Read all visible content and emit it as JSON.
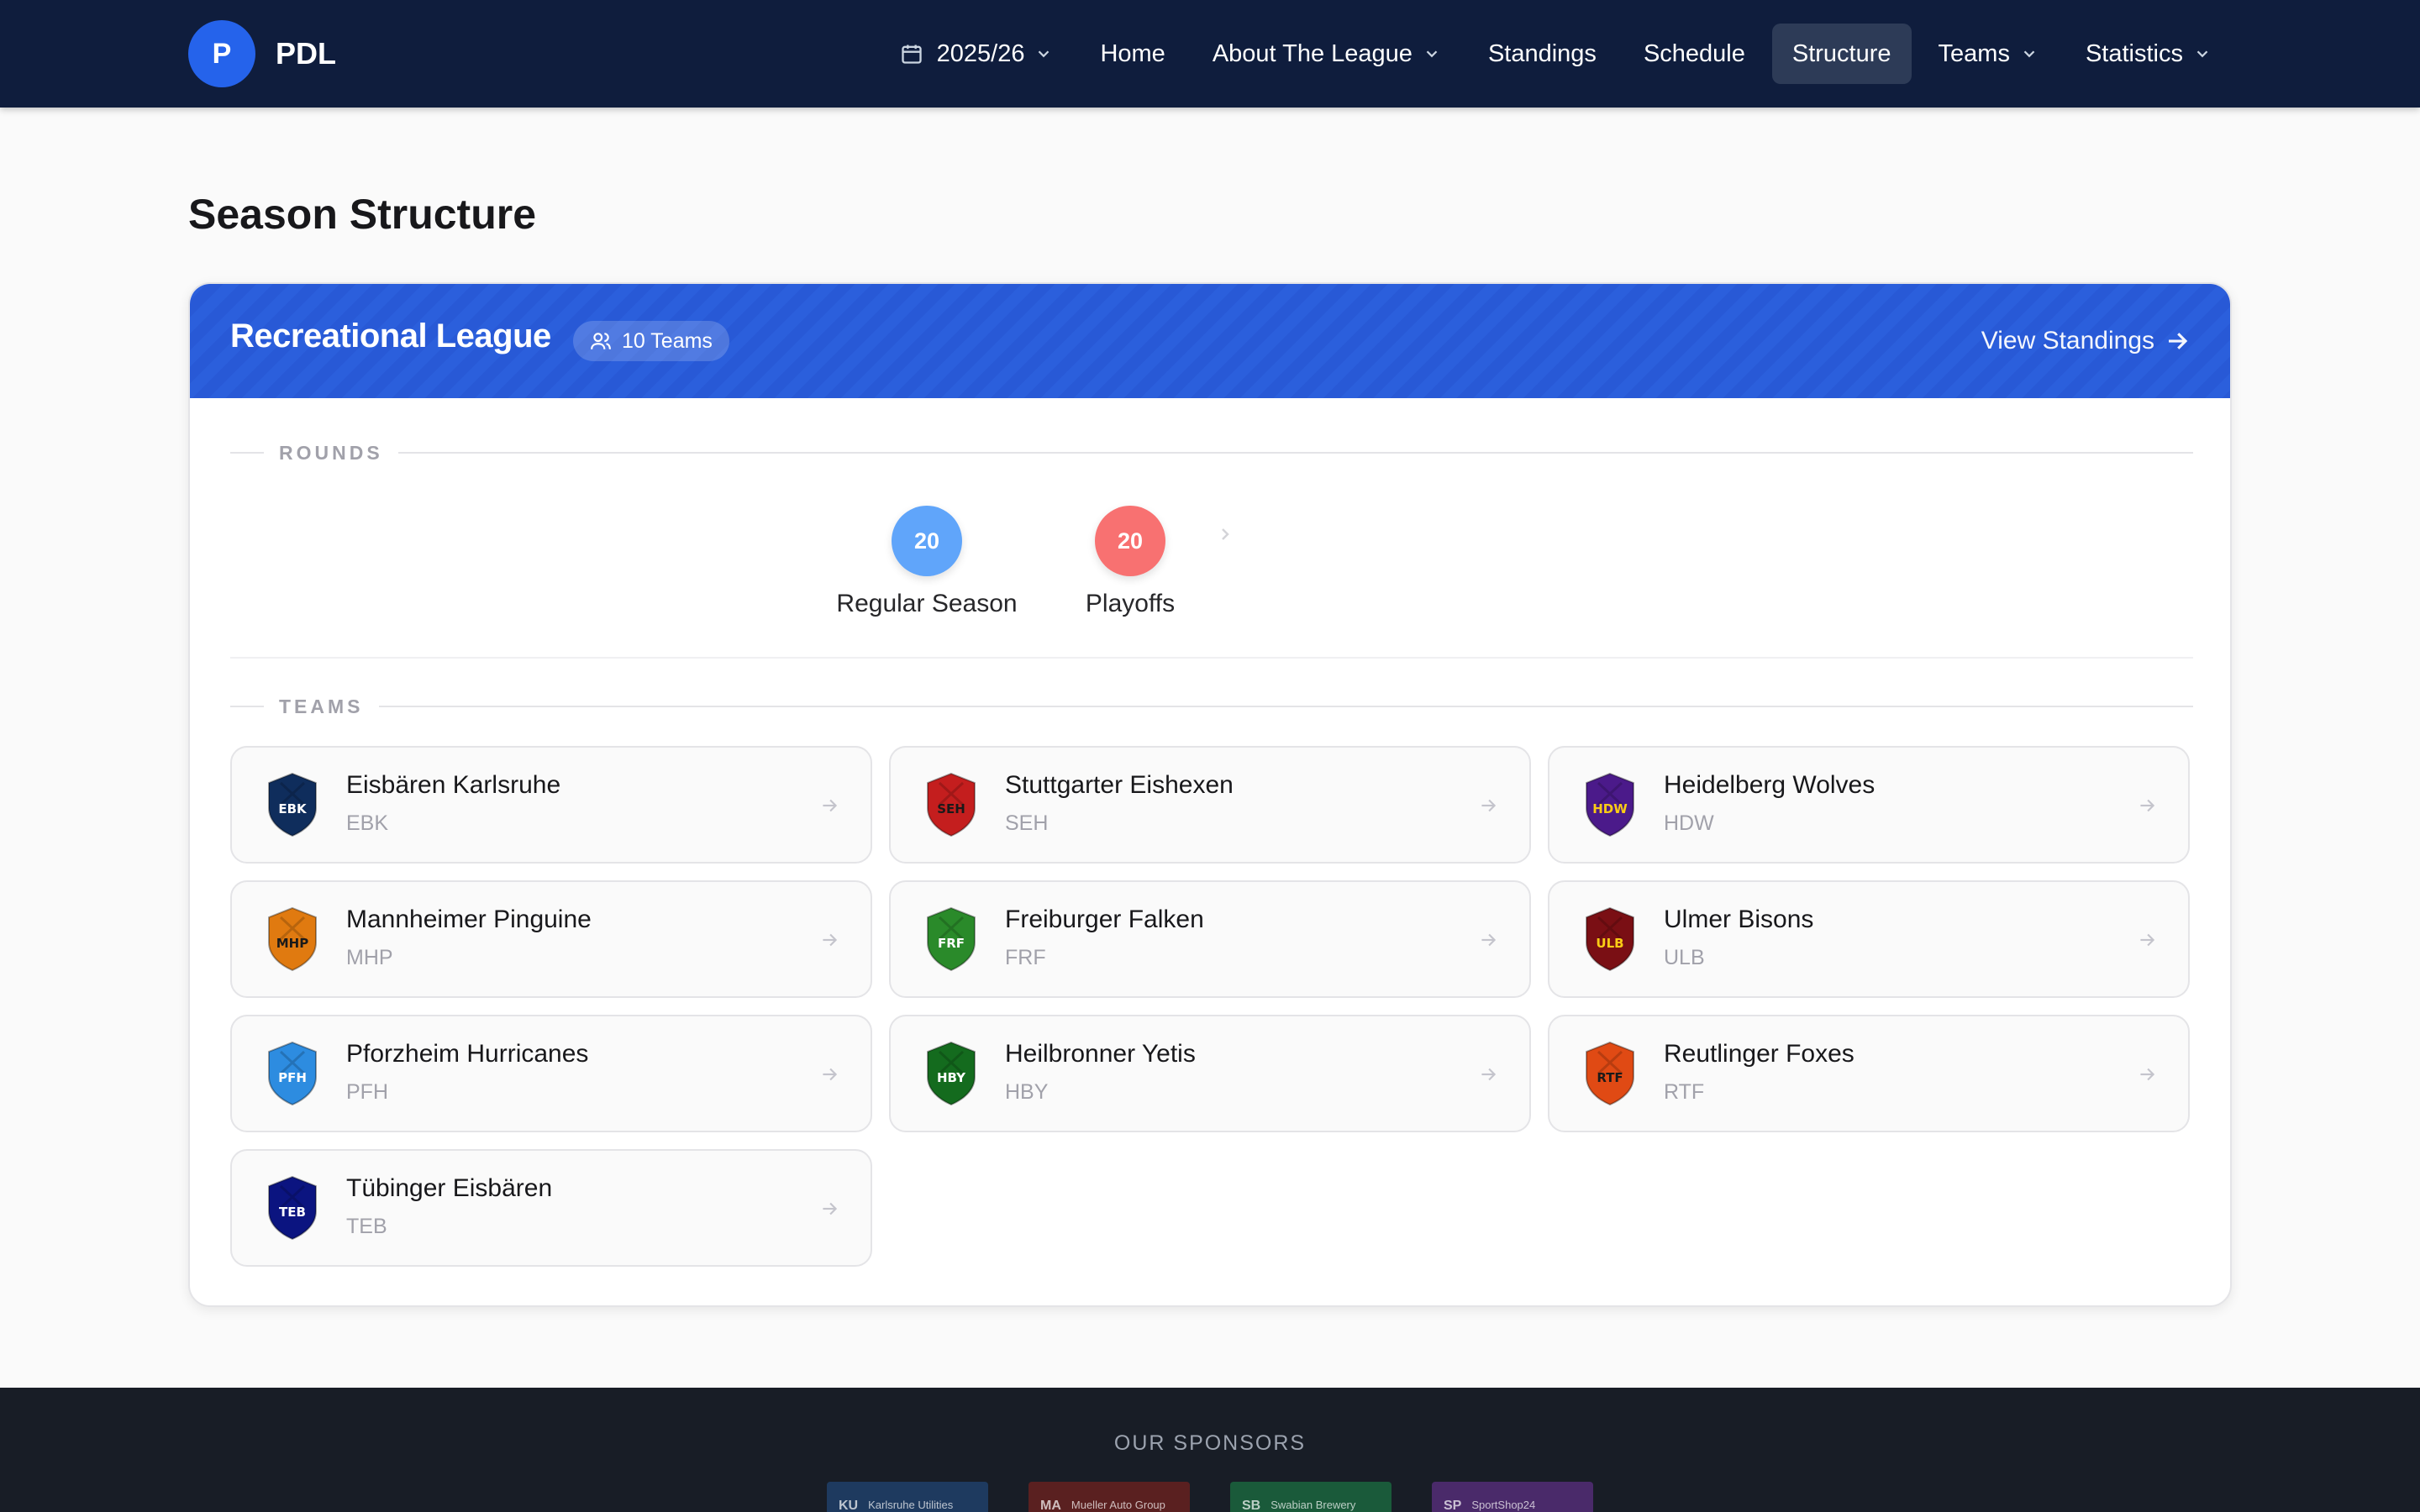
{
  "brand": {
    "logo_letter": "P",
    "name": "PDL"
  },
  "nav": {
    "season": "2025/26",
    "items": [
      {
        "label": "Home",
        "dropdown": false,
        "active": false
      },
      {
        "label": "About The League",
        "dropdown": true,
        "active": false
      },
      {
        "label": "Standings",
        "dropdown": false,
        "active": false
      },
      {
        "label": "Schedule",
        "dropdown": false,
        "active": false
      },
      {
        "label": "Structure",
        "dropdown": false,
        "active": true
      },
      {
        "label": "Teams",
        "dropdown": true,
        "active": false
      },
      {
        "label": "Statistics",
        "dropdown": true,
        "active": false
      }
    ]
  },
  "page": {
    "title": "Season Structure"
  },
  "league": {
    "name": "Recreational League",
    "team_count": "10 Teams",
    "view_standings": "View Standings",
    "rounds_label": "ROUNDS",
    "teams_label": "TEAMS",
    "rounds": [
      {
        "count": "20",
        "name": "Regular Season",
        "color": "#60a5fa"
      },
      {
        "count": "20",
        "name": "Playoffs",
        "color": "#f87171"
      }
    ],
    "teams": [
      {
        "name": "Eisbären Karlsruhe",
        "abbr": "EBK",
        "color": "#0f2d5c",
        "text_color": "#ffffff"
      },
      {
        "name": "Stuttgarter Eishexen",
        "abbr": "SEH",
        "color": "#c41e1e",
        "text_color": "#1a1a1a"
      },
      {
        "name": "Heidelberg Wolves",
        "abbr": "HDW",
        "color": "#4b1a8a",
        "text_color": "#facc15"
      },
      {
        "name": "Mannheimer Pinguine",
        "abbr": "MHP",
        "color": "#e07a10",
        "text_color": "#1a1a1a"
      },
      {
        "name": "Freiburger Falken",
        "abbr": "FRF",
        "color": "#2a8a2a",
        "text_color": "#ffffff"
      },
      {
        "name": "Ulmer Bisons",
        "abbr": "ULB",
        "color": "#7a0f14",
        "text_color": "#facc15"
      },
      {
        "name": "Pforzheim Hurricanes",
        "abbr": "PFH",
        "color": "#2d8ce0",
        "text_color": "#ffffff"
      },
      {
        "name": "Heilbronner Yetis",
        "abbr": "HBY",
        "color": "#146b1e",
        "text_color": "#ffffff"
      },
      {
        "name": "Reutlinger Foxes",
        "abbr": "RTF",
        "color": "#e04a14",
        "text_color": "#1a1a1a"
      },
      {
        "name": "Tübinger Eisbären",
        "abbr": "TEB",
        "color": "#0b1480",
        "text_color": "#ffffff"
      }
    ]
  },
  "footer": {
    "sponsors_label": "OUR SPONSORS",
    "sponsors": [
      {
        "abbr": "KU",
        "name": "Karlsruhe Utilities",
        "color": "#1e3a5f"
      },
      {
        "abbr": "MA",
        "name": "Mueller Auto Group",
        "color": "#5a2020"
      },
      {
        "abbr": "SB",
        "name": "Swabian Brewery",
        "color": "#1a5a3a"
      },
      {
        "abbr": "SP",
        "name": "SportShop24",
        "color": "#4a2a6a"
      }
    ]
  }
}
